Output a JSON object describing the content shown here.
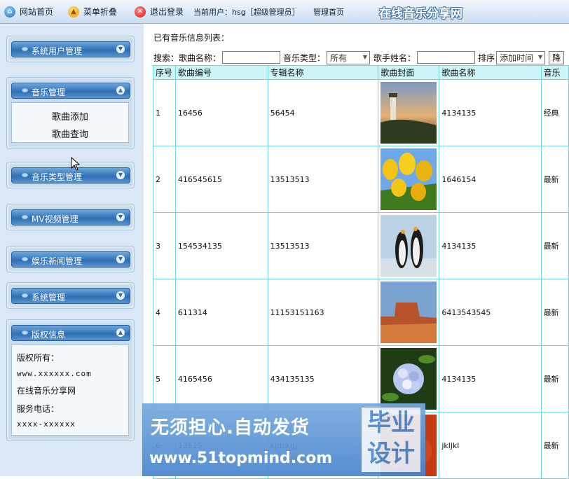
{
  "topbar": {
    "home": "网站首页",
    "fold_menu": "菜单折叠",
    "logout": "退出登录",
    "current_user": "当前用户：hsg［超级管理员］",
    "admin_home": "管理首页",
    "site_title": "在线音乐分享网"
  },
  "sidebar": {
    "panels": [
      {
        "title": "系统用户管理"
      },
      {
        "title": "音乐管理",
        "items": [
          "歌曲添加",
          "歌曲查询"
        ]
      },
      {
        "title": "音乐类型管理"
      },
      {
        "title": "MV视频管理"
      },
      {
        "title": "娱乐新闻管理"
      },
      {
        "title": "系统管理"
      },
      {
        "title": "版权信息"
      }
    ],
    "copyright": {
      "owner_label": "版权所有：",
      "website": "www.xxxxxx.com",
      "site_name": "在线音乐分享网",
      "phone_label": "服务电话：",
      "phone": "xxxx-xxxxxx"
    }
  },
  "main": {
    "list_title": "已有音乐信息列表：",
    "search": {
      "label": "搜索：",
      "song_name_label": "歌曲名称：",
      "type_label": "音乐类型：",
      "type_value": "所有",
      "singer_label": "歌手姓名：",
      "sort_label": "排序",
      "sort_value": "添加时间",
      "order_button": "降"
    },
    "columns": [
      "序号",
      "歌曲编号",
      "专辑名称",
      "歌曲封面",
      "歌曲名称",
      "音乐"
    ],
    "rows": [
      {
        "no": "1",
        "code": "16456",
        "album": "56454",
        "name": "4134135",
        "type": "经典"
      },
      {
        "no": "2",
        "code": "416545615",
        "album": "13513513",
        "name": "1646154",
        "type": "最新"
      },
      {
        "no": "3",
        "code": "154534135",
        "album": "13513513",
        "name": "4134135",
        "type": "最新"
      },
      {
        "no": "4",
        "code": "611314",
        "album": "11153151163",
        "name": "6413543545",
        "type": "最新"
      },
      {
        "no": "5",
        "code": "4165456",
        "album": "434135135",
        "name": "4134135",
        "type": "最新"
      },
      {
        "no": "6",
        "code": "13515",
        "album": "kjdskgj",
        "name": "jkljkl",
        "type": "最新"
      }
    ]
  },
  "watermark": {
    "line1": "无须担心.自动发货",
    "line2": "www.51topmind.com",
    "badge": "毕业\n设计"
  }
}
